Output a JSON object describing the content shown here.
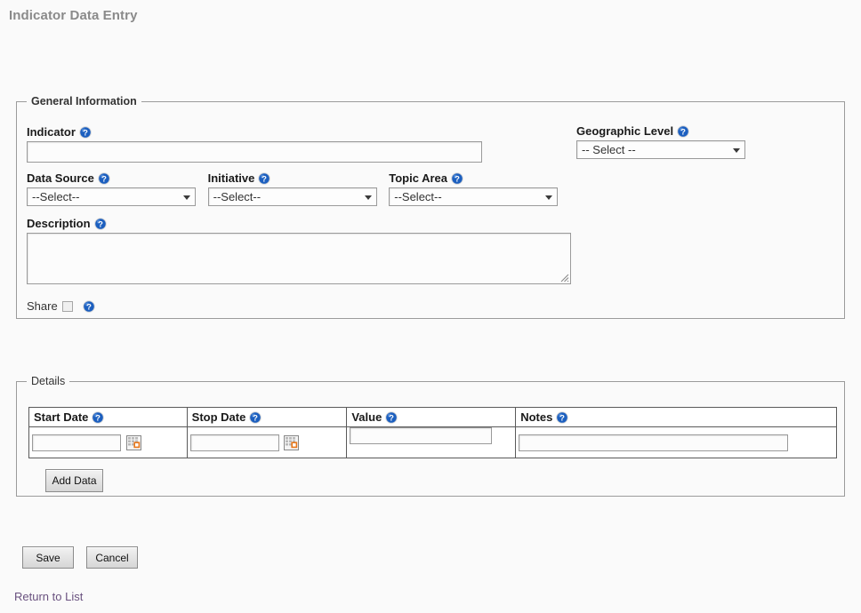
{
  "page": {
    "title": "Indicator Data Entry"
  },
  "general_information": {
    "legend": "General Information",
    "indicator": {
      "label": "Indicator",
      "value": "",
      "help_icon": "help-icon"
    },
    "geographic_level": {
      "label": "Geographic Level",
      "selected": "-- Select --",
      "help_icon": "help-icon"
    },
    "data_source": {
      "label": "Data Source",
      "selected": "--Select--",
      "help_icon": "help-icon"
    },
    "initiative": {
      "label": "Initiative",
      "selected": "--Select--",
      "help_icon": "help-icon"
    },
    "topic_area": {
      "label": "Topic Area",
      "selected": "--Select--",
      "help_icon": "help-icon"
    },
    "description": {
      "label": "Description",
      "value": "",
      "help_icon": "help-icon"
    },
    "share": {
      "label": "Share",
      "checked": false,
      "help_icon": "help-icon"
    }
  },
  "details": {
    "legend": "Details",
    "columns": [
      {
        "label": "Start Date",
        "help_icon": "help-icon"
      },
      {
        "label": "Stop Date",
        "help_icon": "help-icon"
      },
      {
        "label": "Value",
        "help_icon": "help-icon"
      },
      {
        "label": "Notes",
        "help_icon": "help-icon"
      }
    ],
    "rows": [
      {
        "start_date": "",
        "stop_date": "",
        "value": "",
        "notes": "",
        "start_date_picker_icon": "calendar-icon",
        "stop_date_picker_icon": "calendar-icon"
      }
    ],
    "add_data_label": "Add Data"
  },
  "footer": {
    "save_label": "Save",
    "cancel_label": "Cancel",
    "return_link_label": "Return to List"
  },
  "colors": {
    "page_background": "#fafafa",
    "title_text": "#8a8a8a",
    "fieldset_border": "#9b9b9b",
    "help_icon_blue": "#1c5fbf",
    "calendar_accent_orange": "#e8771a",
    "link_purple": "#69517f",
    "table_border": "#5a5a5a"
  }
}
